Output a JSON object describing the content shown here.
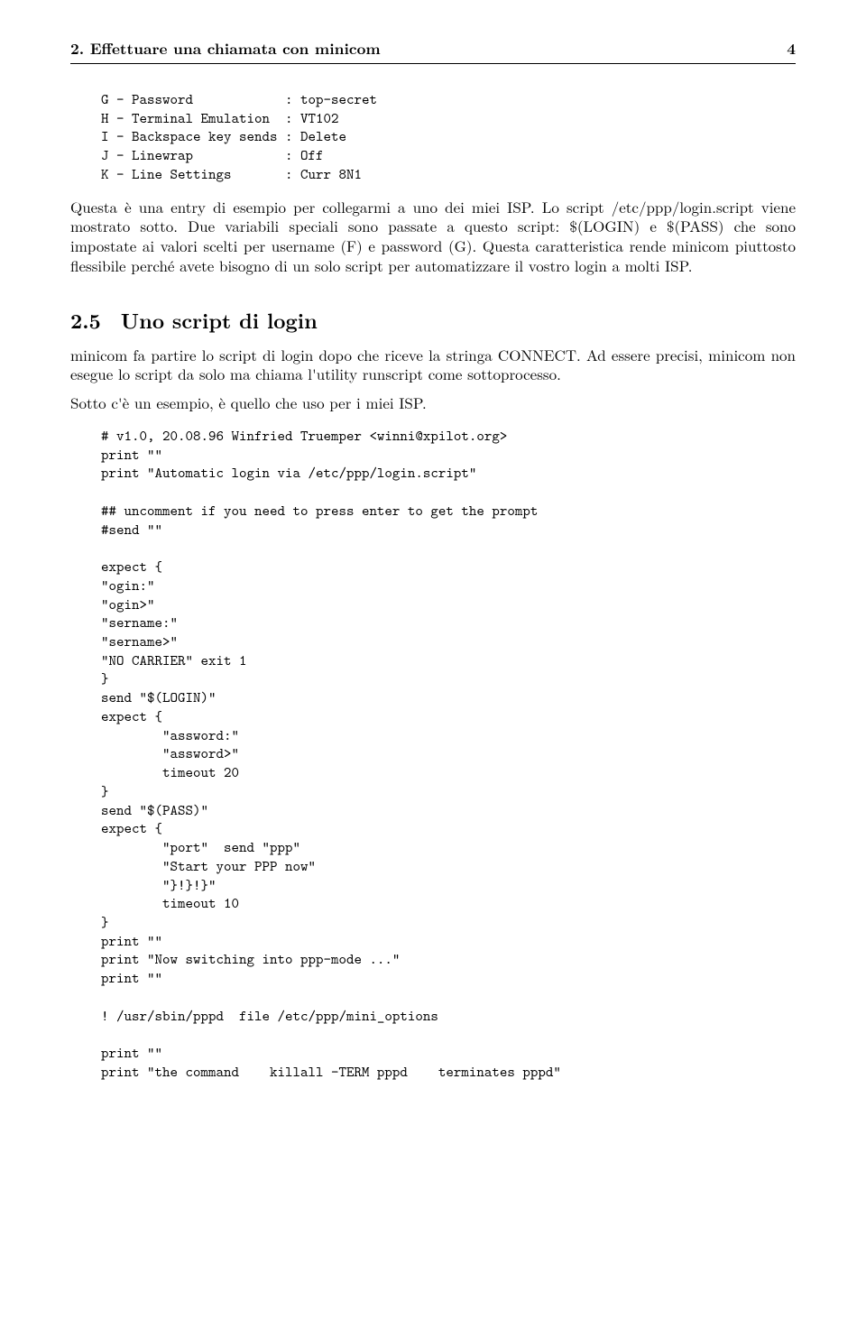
{
  "header": {
    "title": "2. Effettuare una chiamata con minicom",
    "page_number": "4"
  },
  "config_block": "    G - Password            : top-secret\n    H - Terminal Emulation  : VT102\n    I - Backspace key sends : Delete\n    J - Linewrap            : Off\n    K - Line Settings       : Curr 8N1",
  "para1": "Questa è una entry di esempio per collegarmi a uno dei miei ISP. Lo script /etc/ppp/login.script viene mostrato sotto. Due variabili speciali sono passate a questo script: $(LOGIN) e $(PASS) che sono impostate ai valori scelti per username (F) e password (G). Questa caratteristica rende minicom piuttosto flessibile perché avete bisogno di un solo script per automatizzare il vostro login a molti ISP.",
  "section": {
    "num": "2.5",
    "title": "Uno script di login"
  },
  "para2": "minicom fa partire lo script di login dopo che riceve la stringa CONNECT. Ad essere precisi, minicom non esegue lo script da solo ma chiama l'utility runscript come sottoprocesso.",
  "para3": "Sotto c'è un esempio, è quello che uso per i miei ISP.",
  "script_block": "    # v1.0, 20.08.96 Winfried Truemper <winni@xpilot.org>\n    print \"\"\n    print \"Automatic login via /etc/ppp/login.script\"\n\n    ## uncomment if you need to press enter to get the prompt\n    #send \"\"\n\n    expect {\n    \"ogin:\"\n    \"ogin>\"\n    \"sername:\"\n    \"sername>\"\n    \"NO CARRIER\" exit 1\n    }\n    send \"$(LOGIN)\"\n    expect {\n            \"assword:\"\n            \"assword>\"\n            timeout 20\n    }\n    send \"$(PASS)\"\n    expect {\n            \"port\"  send \"ppp\"\n            \"Start your PPP now\"\n            \"}!}!}\"\n            timeout 10\n    }\n    print \"\"\n    print \"Now switching into ppp-mode ...\"\n    print \"\"\n\n    ! /usr/sbin/pppd  file /etc/ppp/mini_options\n\n    print \"\"\n    print \"the command    killall -TERM pppd    terminates pppd\""
}
